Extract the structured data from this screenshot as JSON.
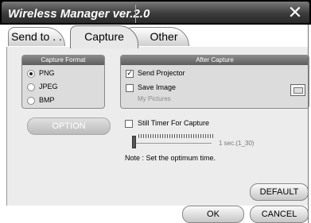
{
  "window": {
    "title": "Wireless Manager ver.2.0",
    "close_glyph": "✕"
  },
  "tabs": [
    "Send to . .",
    "Capture",
    "Other"
  ],
  "capture_format": {
    "header": "Capture Format",
    "options": [
      "PNG",
      "JPEG",
      "BMP"
    ],
    "selected": "PNG"
  },
  "after_capture": {
    "header": "After Capture",
    "send_projector": {
      "label": "Send Projector",
      "checked": true
    },
    "save_image": {
      "label": "Save Image",
      "checked": false
    },
    "save_path": "My Pictures"
  },
  "option_button": "OPTION",
  "still_timer": {
    "label": "Still Timer For Capture",
    "checked": false,
    "value_text": "1 sec.(1_30)"
  },
  "note": "Note :  Set the optimum time.",
  "buttons": {
    "default": "DEFAULT",
    "ok": "OK",
    "cancel": "CANCEL"
  },
  "colors": {
    "title_bg": "#3c3c3c",
    "panel_bg": "#ececec",
    "group_header": "#6e6e6e"
  }
}
